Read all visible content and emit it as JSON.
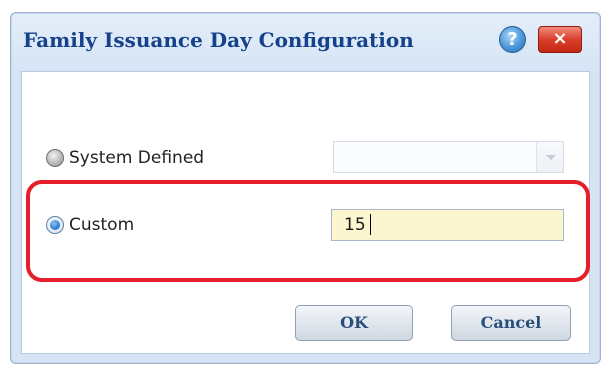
{
  "dialog": {
    "title": "Family Issuance Day Configuration",
    "help_label": "?",
    "close_label": "×"
  },
  "options": {
    "system_defined": {
      "label": "System Defined",
      "selected": false,
      "combo_value": ""
    },
    "custom": {
      "label": "Custom",
      "selected": true,
      "value": "15"
    }
  },
  "buttons": {
    "ok_label": "OK",
    "cancel_label": "Cancel"
  },
  "colors": {
    "title_text": "#15428b",
    "highlight_border": "#e41e2a",
    "input_background": "#fbf6cf",
    "close_button": "#d9402c",
    "help_button": "#4b96d8"
  }
}
